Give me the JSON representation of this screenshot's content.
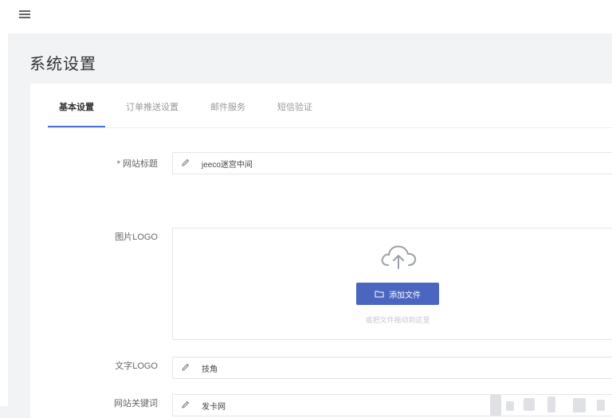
{
  "header": {
    "menu_icon": "hamburger-icon"
  },
  "page": {
    "title": "系统设置"
  },
  "tabs": [
    {
      "label": "基本设置",
      "active": true
    },
    {
      "label": "订单推送设置",
      "active": false
    },
    {
      "label": "邮件服务",
      "active": false
    },
    {
      "label": "短信验证",
      "active": false
    }
  ],
  "form": {
    "site_title": {
      "label": "* 网站标题",
      "value": "jeeco迷宫中间"
    },
    "logo": {
      "label": "图片LOGO",
      "button_label": "添加文件",
      "hint": "或把文件拖动到这里"
    },
    "text_logo": {
      "label": "文字LOGO",
      "value": "技角"
    },
    "keywords": {
      "label": "网站关键词",
      "value": "发卡网"
    }
  },
  "colors": {
    "accent": "#4a66c0",
    "tab_underline": "#4a6fd6",
    "background": "#f2f3f5"
  }
}
